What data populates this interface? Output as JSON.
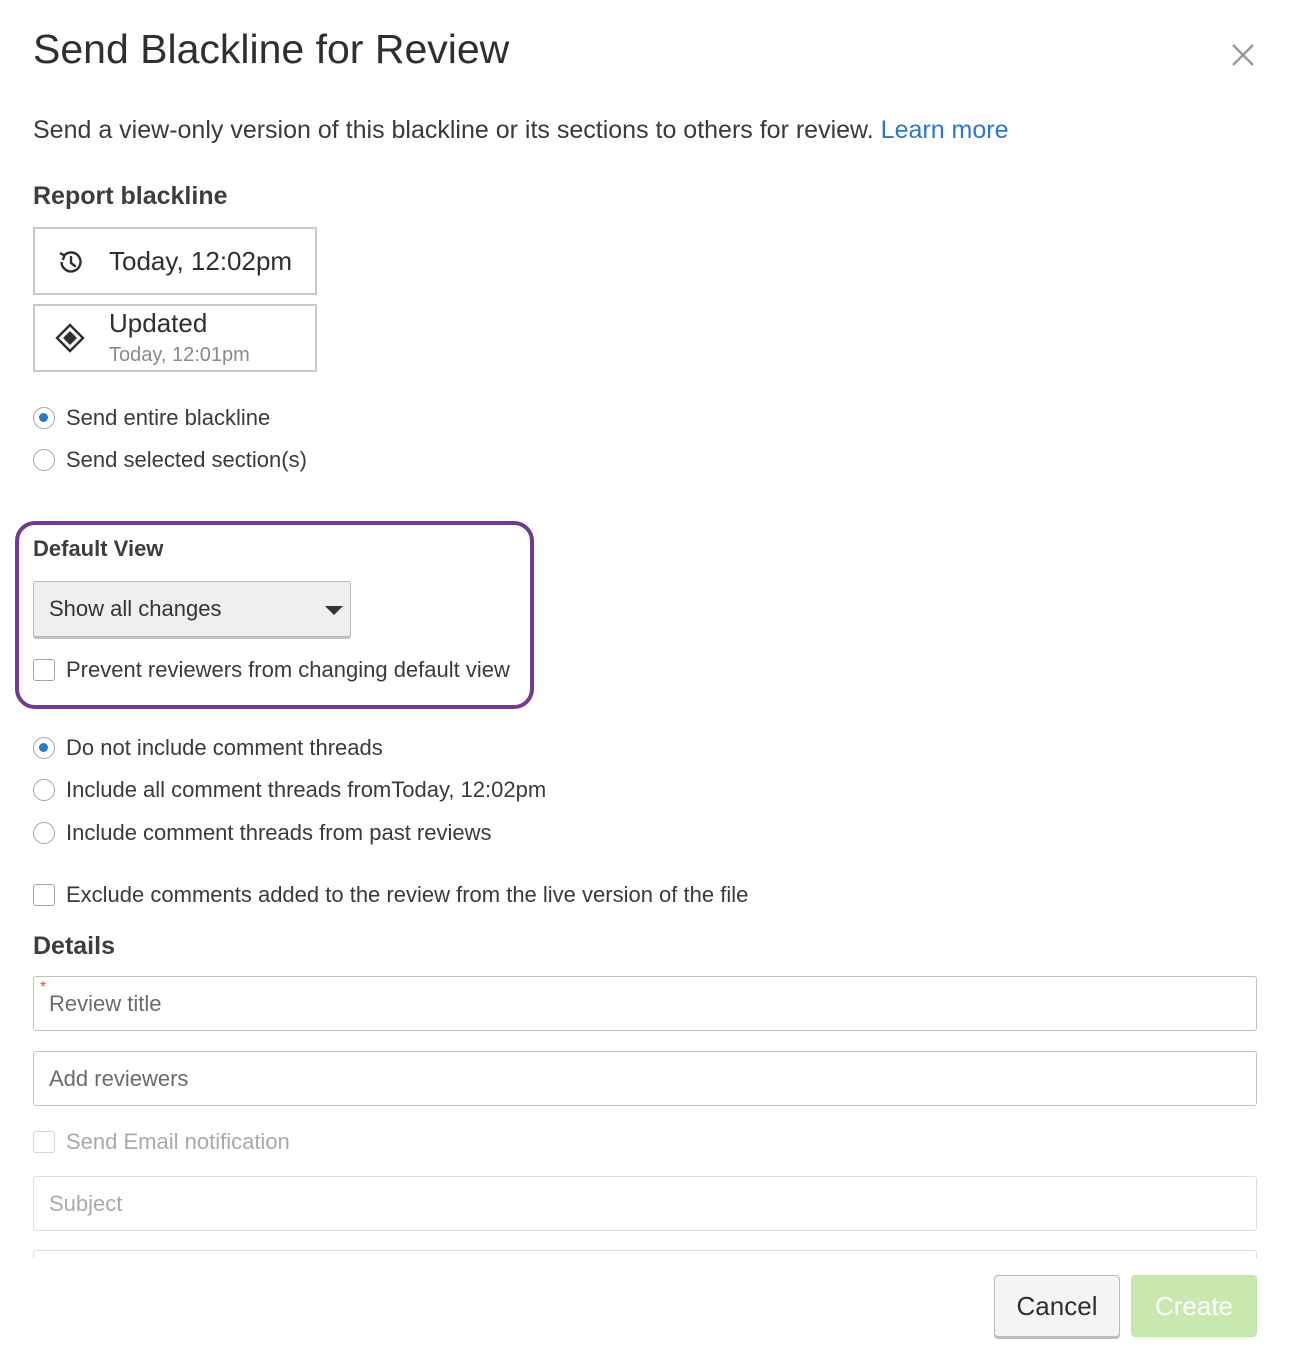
{
  "dialog": {
    "title": "Send Blackline for Review",
    "description": "Send a view-only version of this blackline or its sections to others for review.",
    "learn_more": "Learn more"
  },
  "report_blackline": {
    "label": "Report blackline",
    "current": {
      "icon": "history-icon",
      "text": "Today, 12:02pm"
    },
    "updated": {
      "icon": "diamond-icon",
      "title": "Updated",
      "time": "Today, 12:01pm"
    }
  },
  "scope_options": [
    {
      "label": "Send entire blackline",
      "selected": true
    },
    {
      "label": "Send selected section(s)",
      "selected": false
    }
  ],
  "default_view": {
    "label": "Default View",
    "selected": "Show all changes",
    "prevent_label": "Prevent reviewers from changing default view",
    "prevent_checked": false
  },
  "comment_options": [
    {
      "label": "Do not include comment threads",
      "selected": true
    },
    {
      "label": "Include all comment threads fromToday, 12:02pm",
      "selected": false
    },
    {
      "label": "Include comment threads from past reviews",
      "selected": false
    }
  ],
  "exclude_comments": {
    "label": "Exclude comments added to the review from the live version of the file",
    "checked": false
  },
  "details": {
    "label": "Details",
    "review_title_placeholder": "Review title",
    "required_marker": "*",
    "reviewers_placeholder": "Add reviewers",
    "email_notification_label": "Send Email notification",
    "subject_placeholder": "Subject"
  },
  "buttons": {
    "cancel": "Cancel",
    "create": "Create"
  },
  "colors": {
    "accent": "#2c76cc",
    "highlight": "#6f3b92",
    "create_disabled": "#c8e8b0",
    "required": "#e0582f"
  }
}
